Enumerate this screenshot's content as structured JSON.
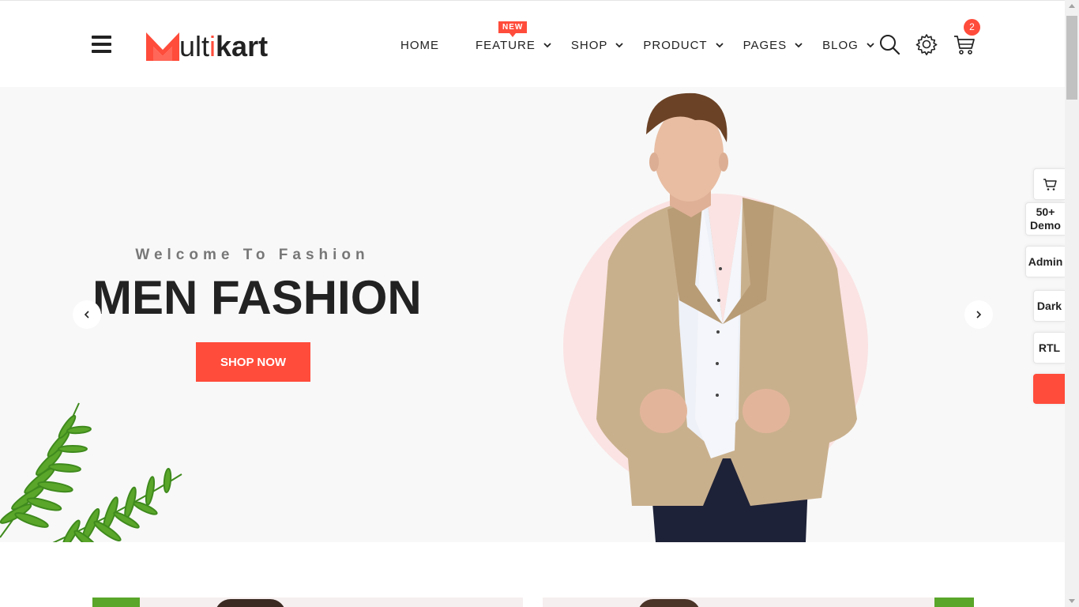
{
  "brand": {
    "logo_first": "ulti",
    "logo_bold": "kart",
    "accent_color": "#ff4c3b"
  },
  "nav": {
    "items": [
      {
        "label": "HOME",
        "has_dropdown": false
      },
      {
        "label": "FEATURE",
        "has_dropdown": true,
        "badge": "NEW"
      },
      {
        "label": "SHOP",
        "has_dropdown": true
      },
      {
        "label": "PRODUCT",
        "has_dropdown": true
      },
      {
        "label": "PAGES",
        "has_dropdown": true
      },
      {
        "label": "BLOG",
        "has_dropdown": true
      }
    ],
    "icons": [
      "search-icon",
      "settings-icon",
      "cart-icon"
    ],
    "cart_count": "2"
  },
  "hero": {
    "subtitle": "Welcome To Fashion",
    "title": "MEN FASHION",
    "button_label": "SHOP NOW",
    "circle_color": "#fbe3e3"
  },
  "side_panel": {
    "items": [
      {
        "label": ""
      },
      {
        "label": "50+ Demo"
      },
      {
        "label": "Admin"
      },
      {
        "label": "Dark"
      },
      {
        "label": "RTL"
      }
    ]
  }
}
